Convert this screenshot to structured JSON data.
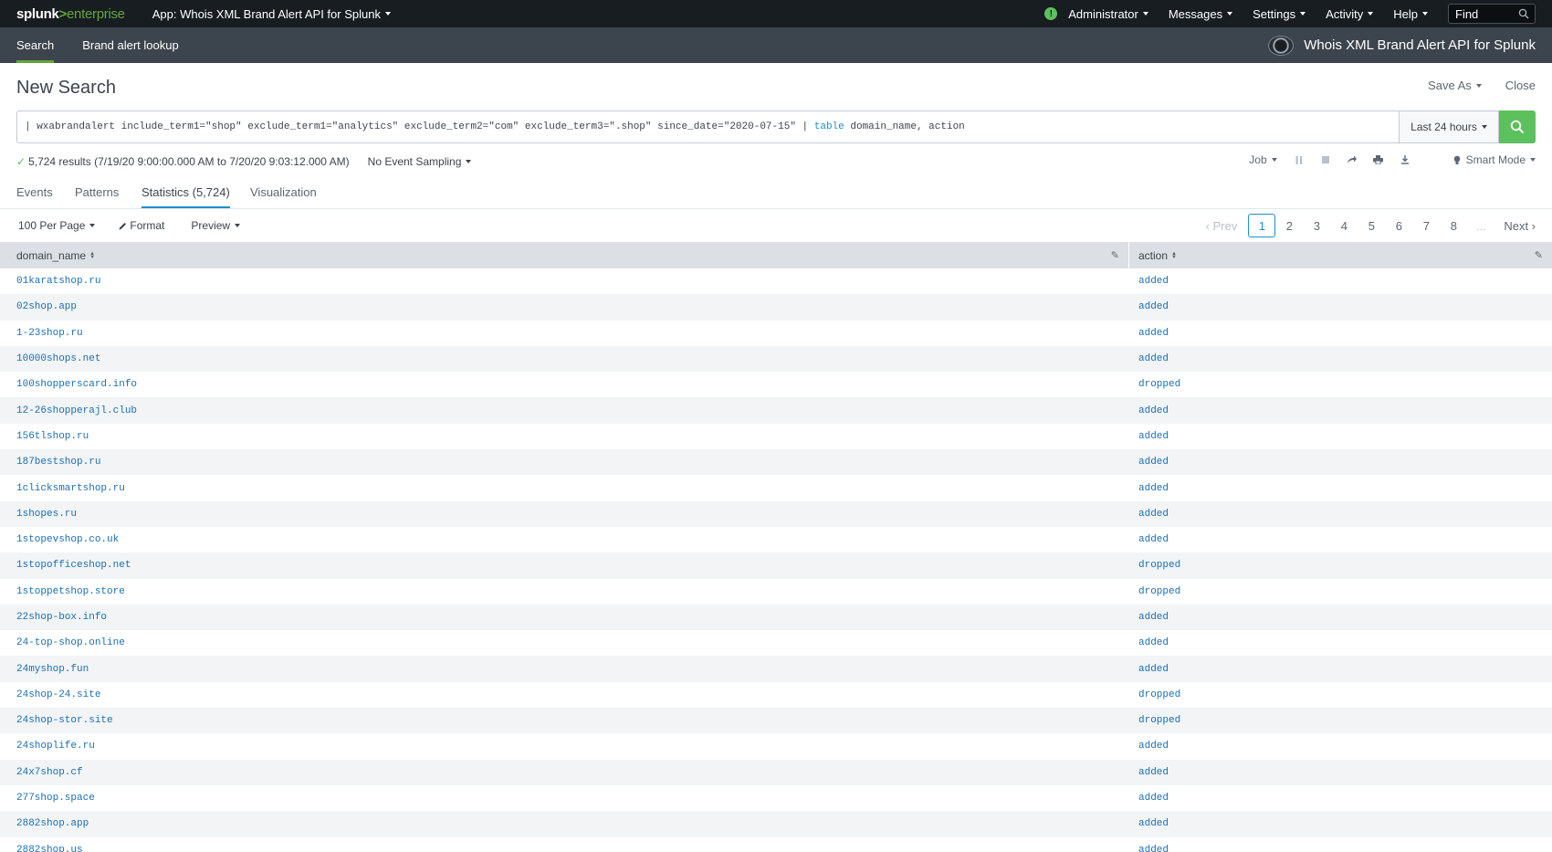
{
  "topbar": {
    "logo_main": "splunk",
    "logo_gt": ">",
    "logo_sub": "enterprise",
    "app_menu": "App: Whois XML Brand Alert API for Splunk",
    "health_icon": "!",
    "menu": [
      "Administrator",
      "Messages",
      "Settings",
      "Activity",
      "Help"
    ],
    "find_placeholder": "Find"
  },
  "appbar": {
    "nav": [
      "Search",
      "Brand alert lookup"
    ],
    "app_title": "Whois XML Brand Alert API for Splunk"
  },
  "search": {
    "page_title": "New Search",
    "save_as": "Save As",
    "close": "Close",
    "query_prefix": "| wxabrandalert include_term1=\"shop\" exclude_term1=\"analytics\" exclude_term2=\"com\" exclude_term3=\".shop\" since_date=\"2020-07-15\" | ",
    "query_keyword": "table",
    "query_suffix": " domain_name, action",
    "time_range": "Last 24 hours",
    "status_check": "✓",
    "results_text": "5,724 results (7/19/20 9:00:00.000 AM to 7/20/20 9:03:12.000 AM)",
    "sampling": "No Event Sampling",
    "job": "Job",
    "smart_mode": "Smart Mode"
  },
  "tabs": [
    "Events",
    "Patterns",
    "Statistics (5,724)",
    "Visualization"
  ],
  "controls": {
    "per_page": "100 Per Page",
    "format": "Format",
    "preview": "Preview",
    "prev": "‹ Prev",
    "pages": [
      "1",
      "2",
      "3",
      "4",
      "5",
      "6",
      "7",
      "8"
    ],
    "dots": "...",
    "next": "Next ›"
  },
  "table": {
    "columns": [
      "domain_name",
      "action"
    ],
    "rows": [
      [
        "01karatshop.ru",
        "added"
      ],
      [
        "02shop.app",
        "added"
      ],
      [
        "1-23shop.ru",
        "added"
      ],
      [
        "10000shops.net",
        "added"
      ],
      [
        "100shopperscard.info",
        "dropped"
      ],
      [
        "12-26shopperajl.club",
        "added"
      ],
      [
        "156tlshop.ru",
        "added"
      ],
      [
        "187bestshop.ru",
        "added"
      ],
      [
        "1clicksmartshop.ru",
        "added"
      ],
      [
        "1shopes.ru",
        "added"
      ],
      [
        "1stopevshop.co.uk",
        "added"
      ],
      [
        "1stopofficeshop.net",
        "dropped"
      ],
      [
        "1stoppetshop.store",
        "dropped"
      ],
      [
        "22shop-box.info",
        "added"
      ],
      [
        "24-top-shop.online",
        "added"
      ],
      [
        "24myshop.fun",
        "added"
      ],
      [
        "24shop-24.site",
        "dropped"
      ],
      [
        "24shop-stor.site",
        "dropped"
      ],
      [
        "24shoplife.ru",
        "added"
      ],
      [
        "24x7shop.cf",
        "added"
      ],
      [
        "277shop.space",
        "added"
      ],
      [
        "2882shop.app",
        "added"
      ],
      [
        "2882shop.us",
        "added"
      ]
    ]
  }
}
